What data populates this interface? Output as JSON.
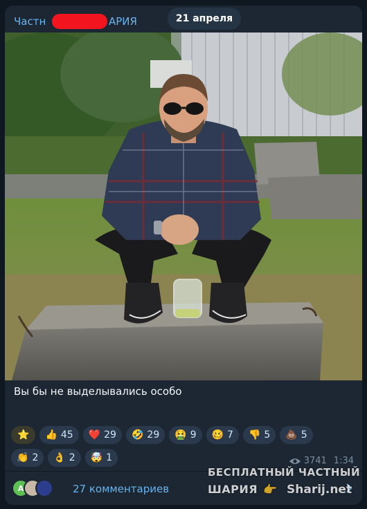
{
  "post": {
    "channel_name_start": "Частн",
    "channel_name_end": "АРИЯ",
    "date": "21 апреля",
    "caption": "Вы бы не выделывались особо",
    "views": "3741",
    "time": "1:34",
    "comments_label": "27 комментариев",
    "avatar_letter": "A"
  },
  "reactions": [
    [
      {
        "emoji": "⭐",
        "count": ""
      },
      {
        "emoji": "👍",
        "count": "45"
      },
      {
        "emoji": "❤️",
        "count": "29"
      },
      {
        "emoji": "🤣",
        "count": "29"
      },
      {
        "emoji": "🤮",
        "count": "9"
      },
      {
        "emoji": "🥴",
        "count": "7"
      },
      {
        "emoji": "👎",
        "count": "5"
      },
      {
        "emoji": "💩",
        "count": "5"
      }
    ],
    [
      {
        "emoji": "👏",
        "count": "2"
      },
      {
        "emoji": "👌",
        "count": "2"
      },
      {
        "emoji": "🤯",
        "count": "1"
      }
    ]
  ],
  "watermark": {
    "line1": "БЕСПЛАТНЫЙ ЧАСТНЫЙ",
    "line2": "ШАРИЯ",
    "hand": "👉",
    "site": "Sharij.net"
  },
  "colors": {
    "accent": "#67b5f0",
    "card_bg": "#1c2733",
    "page_bg": "#0f1721",
    "reaction_bg": "#2a3a4c",
    "redaction": "#f2141f"
  }
}
